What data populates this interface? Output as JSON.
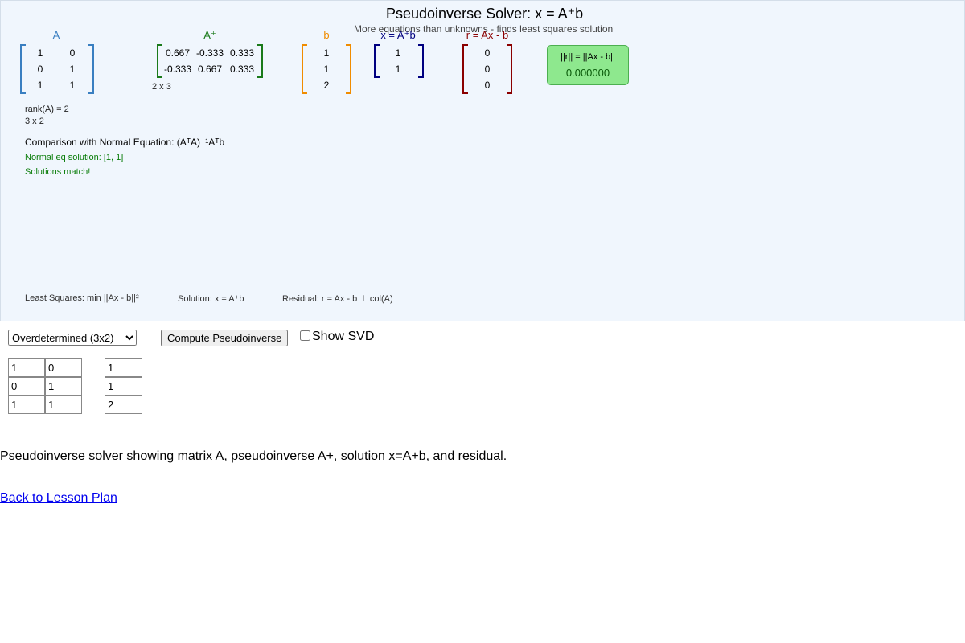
{
  "canvas": {
    "title": "Pseudoinverse Solver: x = A⁺b",
    "subtitle": "More equations than unknowns - finds least squares solution",
    "matrix_A": {
      "label": "A",
      "rows": [
        [
          "1",
          "0"
        ],
        [
          "0",
          "1"
        ],
        [
          "1",
          "1"
        ]
      ],
      "color": "#3a7fc1"
    },
    "matrix_Aplus": {
      "label": "A⁺",
      "rows": [
        [
          "0.667",
          "-0.333",
          "0.333"
        ],
        [
          "-0.333",
          "0.667",
          "0.333"
        ]
      ],
      "dims": "2 x 3",
      "color": "#1a7a1a"
    },
    "vector_b": {
      "label": "b",
      "values": [
        "1",
        "1",
        "2"
      ],
      "color": "#f08c00"
    },
    "vector_x": {
      "label": "x = A⁺b",
      "values": [
        "1",
        "1"
      ],
      "color": "#000080"
    },
    "vector_r": {
      "label": "r = Ax - b",
      "values": [
        "0",
        "0",
        "0"
      ],
      "color": "#8b0000"
    },
    "residual_norm": {
      "label": "||r|| = ||Ax - b||",
      "value": "0.000000"
    },
    "rank_text": "rank(A) = 2",
    "dims_A": "3 x 2",
    "normal_eq_title": "Comparison with Normal Equation: (AᵀA)⁻¹Aᵀb",
    "normal_eq_solution": "Normal eq solution: [1, 1]",
    "match_text": "Solutions match!",
    "footer": {
      "least_squares": "Least Squares: min ||Ax - b||²",
      "solution": "Solution: x = A⁺b",
      "residual": "Residual: r = Ax - b ⊥ col(A)"
    }
  },
  "controls": {
    "preset_selected": "Overdetermined (3x2)",
    "compute_label": "Compute Pseudoinverse",
    "show_svd_label": "Show SVD",
    "show_svd_checked": false,
    "input_A": [
      [
        "1",
        "0"
      ],
      [
        "0",
        "1"
      ],
      [
        "1",
        "1"
      ]
    ],
    "input_b": [
      "1",
      "1",
      "2"
    ]
  },
  "description": "Pseudoinverse solver showing matrix A, pseudoinverse A+, solution x=A+b, and residual.",
  "back_link": "Back to Lesson Plan"
}
